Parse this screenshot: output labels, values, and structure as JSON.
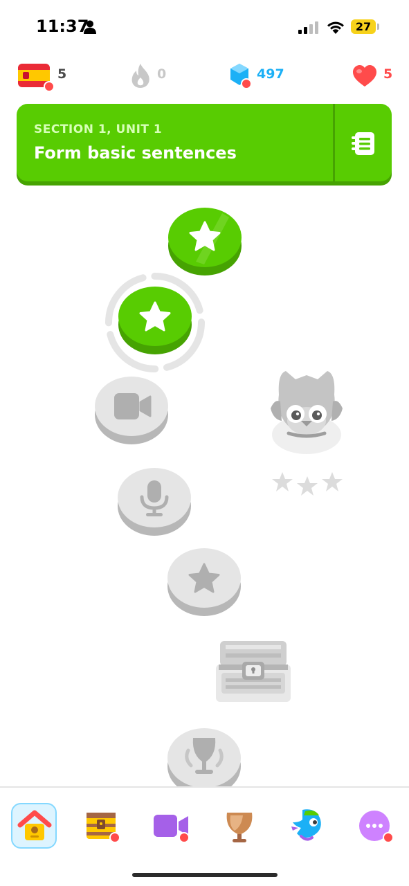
{
  "status_bar": {
    "time": "11:37",
    "battery": "27"
  },
  "stats": {
    "course_flag": "spain-flag-icon",
    "courses_count": "5",
    "streak_count": "0",
    "gems_count": "497",
    "hearts_count": "5"
  },
  "unit_banner": {
    "section_label": "SECTION 1, UNIT 1",
    "title": "Form basic sentences"
  },
  "path": {
    "nodes": [
      {
        "type": "star",
        "state": "completed",
        "icon": "star-icon"
      },
      {
        "type": "star",
        "state": "current",
        "icon": "star-icon"
      },
      {
        "type": "video",
        "state": "locked",
        "icon": "video-camera-icon"
      },
      {
        "type": "speaking",
        "state": "locked",
        "icon": "microphone-icon"
      },
      {
        "type": "star",
        "state": "locked",
        "icon": "star-icon"
      },
      {
        "type": "chest",
        "state": "locked",
        "icon": "treasure-chest-icon"
      },
      {
        "type": "trophy",
        "state": "locked",
        "icon": "trophy-icon"
      }
    ]
  },
  "nav": {
    "items": [
      "home-icon",
      "treasure-chest-icon",
      "video-icon",
      "shield-icon",
      "bird-icon",
      "more-icon"
    ],
    "selected": "home-icon"
  },
  "colors": {
    "green": "#58cc02",
    "green_dark": "#46a302",
    "locked": "#e5e5e5",
    "gems_blue": "#1cb0f6",
    "hearts_red": "#ff4b4b"
  }
}
